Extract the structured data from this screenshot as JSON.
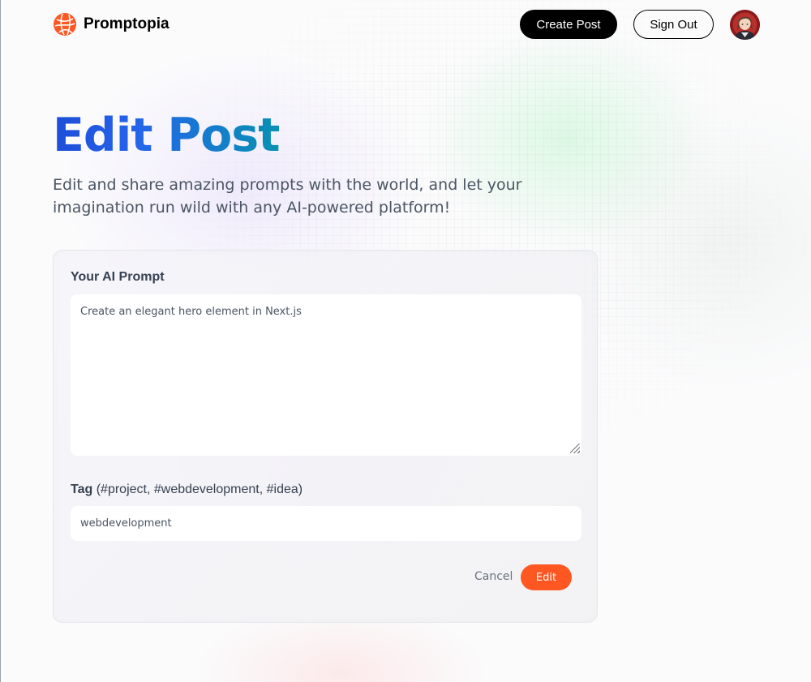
{
  "brand": {
    "name": "Promptopia",
    "logo_icon": "globe-logo-icon",
    "accent": "#ff5722"
  },
  "nav": {
    "create_label": "Create Post",
    "signout_label": "Sign Out",
    "avatar_icon": "user-avatar"
  },
  "hero": {
    "title": "Edit Post",
    "description": "Edit and share amazing prompts with the world, and let your imagination run wild with any AI-powered platform!"
  },
  "form": {
    "prompt_label": "Your AI Prompt",
    "prompt_value": "Create an elegant hero element in Next.js",
    "tag_label_strong": "Tag",
    "tag_label_hint": "(#project, #webdevelopment, #idea)",
    "tag_value": "webdevelopment",
    "cancel_label": "Cancel",
    "submit_label": "Edit"
  }
}
